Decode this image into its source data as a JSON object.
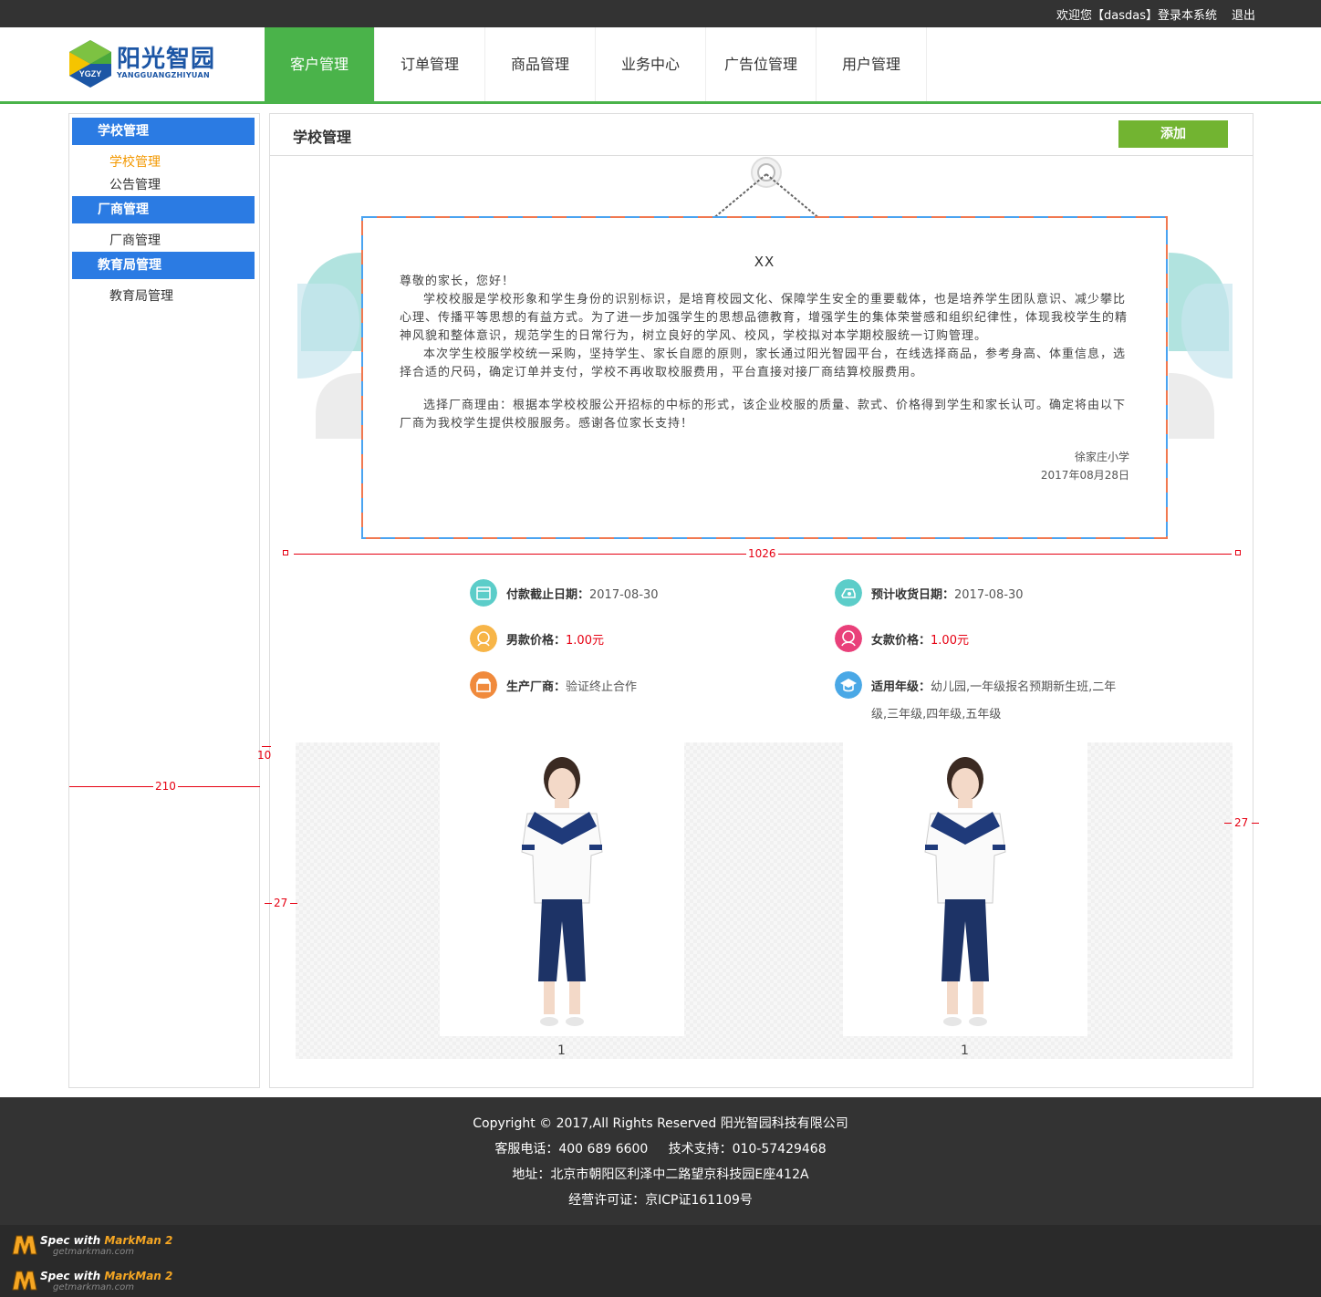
{
  "topbar": {
    "welcome": "欢迎您【dasdas】登录本系统",
    "logout": "退出"
  },
  "brand": {
    "name": "阳光智园",
    "abbr": "YGZY",
    "sub": "YANGGUANGZHIYUAN"
  },
  "nav": {
    "items": [
      {
        "label": "客户管理"
      },
      {
        "label": "订单管理"
      },
      {
        "label": "商品管理"
      },
      {
        "label": "业务中心"
      },
      {
        "label": "广告位管理"
      },
      {
        "label": "用户管理"
      }
    ]
  },
  "sidebar": {
    "groups": [
      {
        "title": "学校管理",
        "links": [
          "学校管理",
          "公告管理"
        ]
      },
      {
        "title": "厂商管理",
        "links": [
          "厂商管理"
        ]
      },
      {
        "title": "教育局管理",
        "links": [
          "教育局管理"
        ]
      }
    ]
  },
  "main": {
    "title": "学校管理",
    "add_label": "添加"
  },
  "letter": {
    "title": "XX",
    "greeting": "尊敬的家长，您好！",
    "p1": "学校校服是学校形象和学生身份的识别标识，是培育校园文化、保障学生安全的重要载体，也是培养学生团队意识、减少攀比心理、传播平等思想的有益方式。为了进一步加强学生的思想品德教育，增强学生的集体荣誉感和组织纪律性，体现我校学生的精神风貌和整体意识，规范学生的日常行为，树立良好的学风、校风，学校拟对本学期校服统一订购管理。",
    "p2": "本次学生校服学校统一采购，坚持学生、家长自愿的原则，家长通过阳光智园平台，在线选择商品，参考身高、体重信息，选择合适的尺码，确定订单并支付，学校不再收取校服费用，平台直接对接厂商结算校服费用。",
    "p3": "选择厂商理由：根据本学校校服公开招标的中标的形式，该企业校服的质量、款式、价格得到学生和家长认可。确定将由以下厂商为我校学生提供校服服务。感谢各位家长支持！",
    "signer": "徐家庄小学",
    "date": "2017年08月28日"
  },
  "info": {
    "pay_deadline_label": "付款截止日期：",
    "pay_deadline": "2017-08-30",
    "receive_label": "预计收货日期：",
    "receive_date": "2017-08-30",
    "male_label": "男款价格：",
    "male_price": "1.00元",
    "female_label": "女款价格：",
    "female_price": "1.00元",
    "maker_label": "生产厂商：",
    "maker": "验证终止合作",
    "grade_label": "适用年级：",
    "grade_line1": "幼儿园,一年级报名预期新生班,二年",
    "grade_line2": "级,三年级,四年级,五年级"
  },
  "gallery": {
    "items": [
      {
        "caption": "1"
      },
      {
        "caption": "1"
      }
    ]
  },
  "markman": {
    "w1026": "1026",
    "w210": "210",
    "h10": "10",
    "h27a": "27",
    "h27b": "27",
    "badge_prefix": "Spec with ",
    "badge_brand": "MarkMan 2",
    "badge_url": "getmarkman.com"
  },
  "footer": {
    "copyright": "Copyright © 2017,All Rights Reserved 阳光智园科技有限公司",
    "phones": "客服电话：400 689 6600     技术支持：010-57429468",
    "address": "地址：北京市朝阳区利泽中二路望京科技园E座412A",
    "license": "经营许可证：京ICP证161109号"
  },
  "colors": {
    "nav_active": "#4ab34a",
    "side_head": "#2b7be3",
    "add_btn": "#72b431",
    "price_red": "#e60012"
  }
}
